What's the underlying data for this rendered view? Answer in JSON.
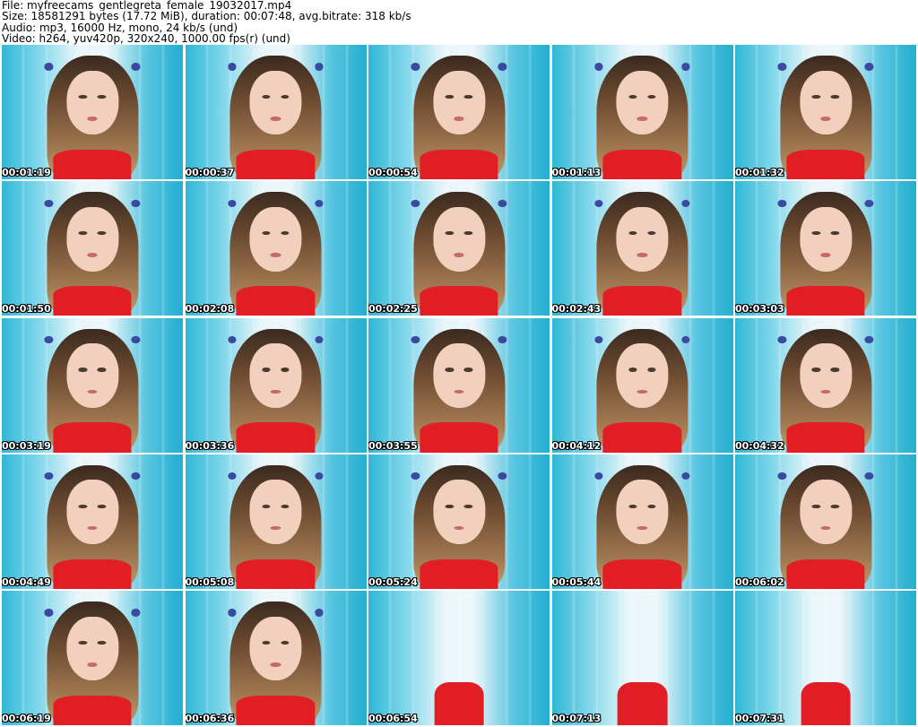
{
  "header": {
    "file_line": "File: myfreecams_gentlegreta_female_19032017.mp4",
    "size_line": "Size: 18581291 bytes (17.72 MiB), duration: 00:07:48, avg.bitrate: 318 kb/s",
    "audio_line": "Audio: mp3, 16000 Hz, mono, 24 kb/s (und)",
    "video_line": "Video: h264, yuv420p, 320x240, 1000.00 fps(r) (und)"
  },
  "thumbnails": [
    {
      "time": "00:01:19"
    },
    {
      "time": "00:00:37"
    },
    {
      "time": "00:00:54"
    },
    {
      "time": "00:01:13"
    },
    {
      "time": "00:01:32"
    },
    {
      "time": "00:01:50"
    },
    {
      "time": "00:02:08"
    },
    {
      "time": "00:02:25"
    },
    {
      "time": "00:02:43"
    },
    {
      "time": "00:03:03"
    },
    {
      "time": "00:03:19"
    },
    {
      "time": "00:03:36"
    },
    {
      "time": "00:03:55"
    },
    {
      "time": "00:04:12"
    },
    {
      "time": "00:04:32"
    },
    {
      "time": "00:04:49"
    },
    {
      "time": "00:05:08"
    },
    {
      "time": "00:05:24"
    },
    {
      "time": "00:05:44"
    },
    {
      "time": "00:06:02"
    },
    {
      "time": "00:06:19"
    },
    {
      "time": "00:06:36"
    },
    {
      "time": "00:06:54"
    },
    {
      "time": "00:07:13"
    },
    {
      "time": "00:07:31"
    }
  ]
}
